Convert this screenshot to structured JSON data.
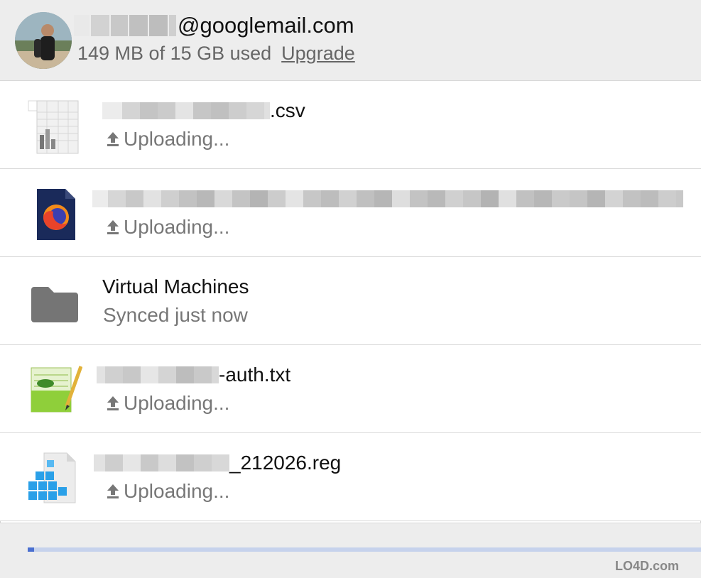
{
  "account": {
    "email_suffix": "@googlemail.com",
    "usage_text": "149 MB of 15 GB used",
    "upgrade_label": "Upgrade"
  },
  "items": [
    {
      "name_suffix": ".csv",
      "status": "Uploading...",
      "icon": "spreadsheet-file-icon"
    },
    {
      "name_suffix": "",
      "status": "Uploading...",
      "icon": "firefox-file-icon"
    },
    {
      "name": "Virtual Machines",
      "status": "Synced just now",
      "icon": "folder-icon"
    },
    {
      "name_suffix": "-auth.txt",
      "status": "Uploading...",
      "icon": "notepad-file-icon"
    },
    {
      "name_suffix": "_212026.reg",
      "status": "Uploading...",
      "icon": "registry-file-icon"
    }
  ],
  "footer": {
    "progress": 0.01
  },
  "watermark": {
    "text": "LO4D.com"
  },
  "colors": {
    "header_bg": "#ededed",
    "progress_fill": "#4a6fd0",
    "progress_track": "#c6d2ec",
    "folder": "#757575"
  }
}
